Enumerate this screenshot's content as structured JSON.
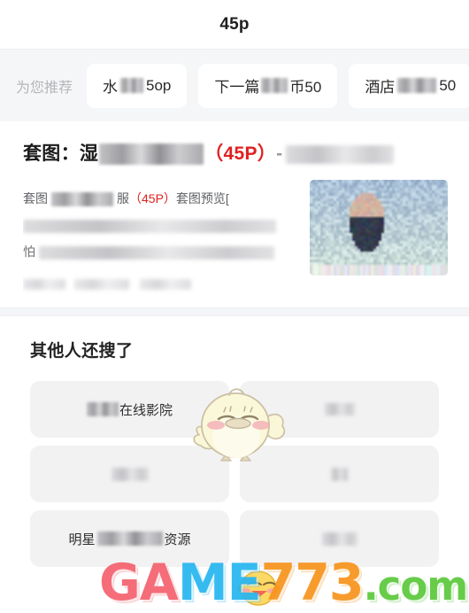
{
  "header": {
    "title": "45p"
  },
  "recommend": {
    "label": "为您推荐",
    "chips": [
      {
        "prefix": "水",
        "redacted": true,
        "suffix": " 5op"
      },
      {
        "prefix": "下一篇",
        "redacted": true,
        "suffix": "币50"
      },
      {
        "prefix": "酒店",
        "redacted": true,
        "suffix": "50"
      }
    ]
  },
  "article": {
    "title_prefix": "套图：湿",
    "title_redacted": true,
    "title_count": "（45P）",
    "title_dash": "-",
    "title_tail_redacted": true,
    "desc_line1_prefix": "套图",
    "desc_line1_mid": "服",
    "desc_line1_count": "（45P）",
    "desc_line1_suffix": "套图预览[",
    "desc_line2_redacted": true,
    "desc_line3_prefix": "怕",
    "desc_line3_redacted": true,
    "desc_line4_redacted": true,
    "thumbnail_alt": "blurred-photo-thumbnail",
    "mascot_alt": "chick-mascot-watermark"
  },
  "related": {
    "title": "其他人还搜了",
    "tiles": [
      {
        "prefix": "",
        "redacted": true,
        "suffix": "在线影院"
      },
      {
        "prefix": "",
        "redacted": true,
        "suffix": ""
      },
      {
        "prefix": "",
        "redacted": true,
        "suffix": ""
      },
      {
        "prefix": "",
        "redacted": true,
        "suffix": ""
      },
      {
        "prefix": "明星",
        "redacted": true,
        "suffix": "资源"
      },
      {
        "prefix": "",
        "redacted": true,
        "suffix": ""
      }
    ]
  },
  "watermark": {
    "part1": "GA",
    "part2": "ME",
    "part3": "773",
    "part4": ".com",
    "color1": "#f4636e",
    "color2": "#27b6f0",
    "color3": "#f7941e",
    "color4": "#5cc93c"
  },
  "colors": {
    "accent_red": "#e02020",
    "page_bg": "#ffffff",
    "strip_bg": "#f5f6f7",
    "tile_bg": "#f2f2f3"
  }
}
